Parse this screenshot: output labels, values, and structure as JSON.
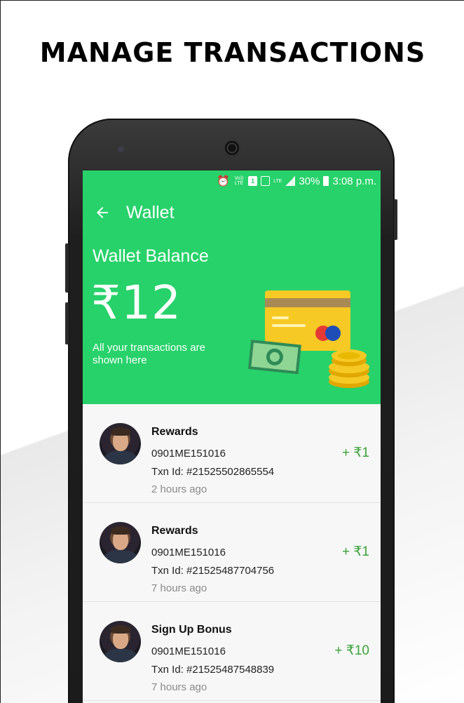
{
  "headline": "MANAGE TRANSACTIONS",
  "status_bar": {
    "volte": "Vo)) LTE",
    "sim": "1",
    "lte": "LTE",
    "battery": "30%",
    "time": "3:08 p.m."
  },
  "app_bar": {
    "title": "Wallet"
  },
  "wallet": {
    "balance_label": "Wallet Balance",
    "balance_value": "₹12",
    "note": "All your transactions are shown here"
  },
  "transactions": [
    {
      "title": "Rewards",
      "code": "0901ME151016",
      "txn": "Txn Id: #21525502865554",
      "time": "2 hours ago",
      "amount": "+ ₹1"
    },
    {
      "title": "Rewards",
      "code": "0901ME151016",
      "txn": "Txn Id: #21525487704756",
      "time": "7 hours ago",
      "amount": "+ ₹1"
    },
    {
      "title": "Sign Up Bonus",
      "code": "0901ME151016",
      "txn": "Txn Id: #21525487548839",
      "time": "7 hours ago",
      "amount": "+ ₹10"
    }
  ],
  "colors": {
    "primary": "#27d26a",
    "amount": "#3aa33a"
  }
}
